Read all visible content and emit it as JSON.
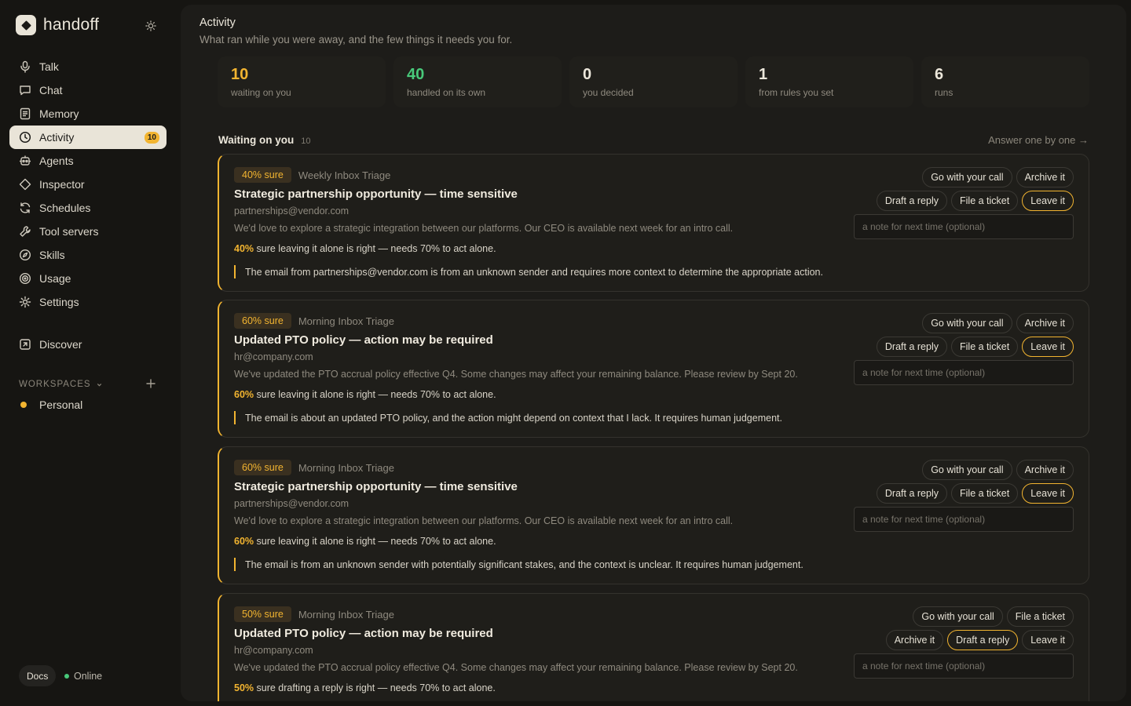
{
  "app": {
    "name": "handoff"
  },
  "nav": {
    "items": [
      {
        "label": "Talk",
        "icon": "microphone-icon"
      },
      {
        "label": "Chat",
        "icon": "chat-bubble-icon"
      },
      {
        "label": "Memory",
        "icon": "document-icon"
      },
      {
        "label": "Activity",
        "icon": "clock-icon",
        "badge": "10",
        "active": true
      },
      {
        "label": "Agents",
        "icon": "robot-icon"
      },
      {
        "label": "Inspector",
        "icon": "diamond-icon"
      },
      {
        "label": "Schedules",
        "icon": "refresh-icon"
      },
      {
        "label": "Tool servers",
        "icon": "wrench-icon"
      },
      {
        "label": "Skills",
        "icon": "compass-icon"
      },
      {
        "label": "Usage",
        "icon": "target-icon"
      },
      {
        "label": "Settings",
        "icon": "gear-icon"
      }
    ],
    "discover": "Discover"
  },
  "workspaces": {
    "label": "WORKSPACES",
    "items": [
      {
        "label": "Personal"
      }
    ]
  },
  "footer": {
    "docs": "Docs",
    "status": "Online"
  },
  "page": {
    "title": "Activity",
    "subtitle": "What ran while you were away, and the few things it needs you for."
  },
  "stats": [
    {
      "value": "10",
      "label": "waiting on you",
      "color": "#f2b430"
    },
    {
      "value": "40",
      "label": "handled on its own",
      "color": "#48c97a"
    },
    {
      "value": "0",
      "label": "you decided",
      "color": "#ece7db"
    },
    {
      "value": "1",
      "label": "from rules you set",
      "color": "#ece7db"
    },
    {
      "value": "6",
      "label": "runs",
      "color": "#ece7db"
    }
  ],
  "section": {
    "title": "Waiting on you",
    "count": "10",
    "link": "Answer one by one →"
  },
  "note_placeholder": "a note for next time (optional)",
  "cards": [
    {
      "badge": "40% sure",
      "source": "Weekly Inbox Triage",
      "title": "Strategic partnership opportunity — time sensitive",
      "from": "partnerships@vendor.com",
      "body": "We'd love to explore a strategic integration between our platforms. Our CEO is available next week for an intro call.",
      "conf_pct": "40%",
      "conf_text": " sure leaving it alone is right — needs 70% to act alone.",
      "reason": "The email from partnerships@vendor.com is from an unknown sender and requires more context to determine the appropriate action.",
      "buttons_row1": [
        "Go with your call",
        "Archive it"
      ],
      "buttons_row2": [
        "Draft a reply",
        "File a ticket",
        "Leave it"
      ]
    },
    {
      "badge": "60% sure",
      "source": "Morning Inbox Triage",
      "title": "Updated PTO policy — action may be required",
      "from": "hr@company.com",
      "body": "We've updated the PTO accrual policy effective Q4. Some changes may affect your remaining balance. Please review by Sept 20.",
      "conf_pct": "60%",
      "conf_text": " sure leaving it alone is right — needs 70% to act alone.",
      "reason": "The email is about an updated PTO policy, and the action might depend on context that I lack. It requires human judgement.",
      "buttons_row1": [
        "Go with your call",
        "Archive it"
      ],
      "buttons_row2": [
        "Draft a reply",
        "File a ticket",
        "Leave it"
      ]
    },
    {
      "badge": "60% sure",
      "source": "Morning Inbox Triage",
      "title": "Strategic partnership opportunity — time sensitive",
      "from": "partnerships@vendor.com",
      "body": "We'd love to explore a strategic integration between our platforms. Our CEO is available next week for an intro call.",
      "conf_pct": "60%",
      "conf_text": " sure leaving it alone is right — needs 70% to act alone.",
      "reason": "The email is from an unknown sender with potentially significant stakes, and the context is unclear. It requires human judgement.",
      "buttons_row1": [
        "Go with your call",
        "Archive it"
      ],
      "buttons_row2": [
        "Draft a reply",
        "File a ticket",
        "Leave it"
      ]
    },
    {
      "badge": "50% sure",
      "source": "Morning Inbox Triage",
      "title": "Updated PTO policy — action may be required",
      "from": "hr@company.com",
      "body": "We've updated the PTO accrual policy effective Q4. Some changes may affect your remaining balance. Please review by Sept 20.",
      "conf_pct": "50%",
      "conf_text": " sure drafting a reply is right — needs 70% to act alone.",
      "reason": "",
      "buttons_row1": [
        "Go with your call",
        "File a ticket"
      ],
      "buttons_row2": [
        "Archive it",
        "Draft a reply",
        "Leave it"
      ]
    }
  ],
  "accent_color": "#f2b430",
  "success_color": "#48c97a"
}
